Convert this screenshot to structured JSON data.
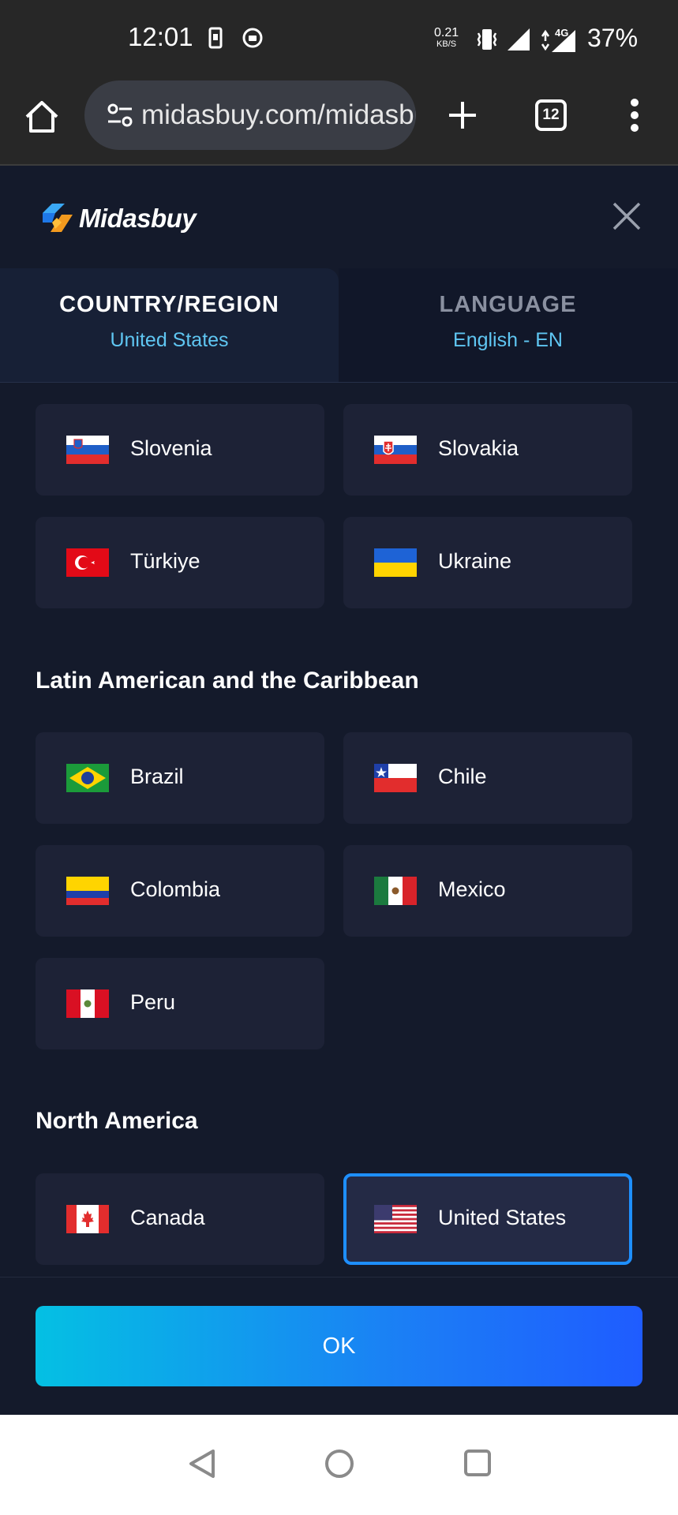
{
  "status_bar": {
    "time": "12:01",
    "net_speed_value": "0.21",
    "net_speed_unit": "KB/S",
    "network_type": "4G",
    "battery": "37%"
  },
  "browser": {
    "url": "midasbuy.com/midasbuy",
    "tab_count": "12"
  },
  "modal": {
    "logo_text": "Midasbuy",
    "tabs": [
      {
        "title": "COUNTRY/REGION",
        "value": "United States",
        "active": true
      },
      {
        "title": "LANGUAGE",
        "value": "English - EN",
        "active": false
      }
    ]
  },
  "regions": [
    {
      "countries": [
        "Slovenia",
        "Slovakia",
        "Türkiye",
        "Ukraine"
      ]
    },
    {
      "title": "Latin American and the Caribbean",
      "countries": [
        "Brazil",
        "Chile",
        "Colombia",
        "Mexico",
        "Peru"
      ]
    },
    {
      "title": "North America",
      "countries": [
        "Canada",
        "United States"
      ]
    }
  ],
  "selected_country": "United States",
  "ok_label": "OK",
  "colors": {
    "background": "#141a2b",
    "card": "#1d2236",
    "accent": "#5fc6f2",
    "selected_border": "#1e8fff",
    "ok_gradient_start": "#04c0e3",
    "ok_gradient_end": "#1f5cff"
  },
  "icons": [
    "home-icon",
    "site-settings-icon",
    "new-tab-icon",
    "tabs-icon",
    "more-menu-icon",
    "close-icon",
    "back-nav-icon",
    "home-nav-icon",
    "recents-nav-icon"
  ]
}
